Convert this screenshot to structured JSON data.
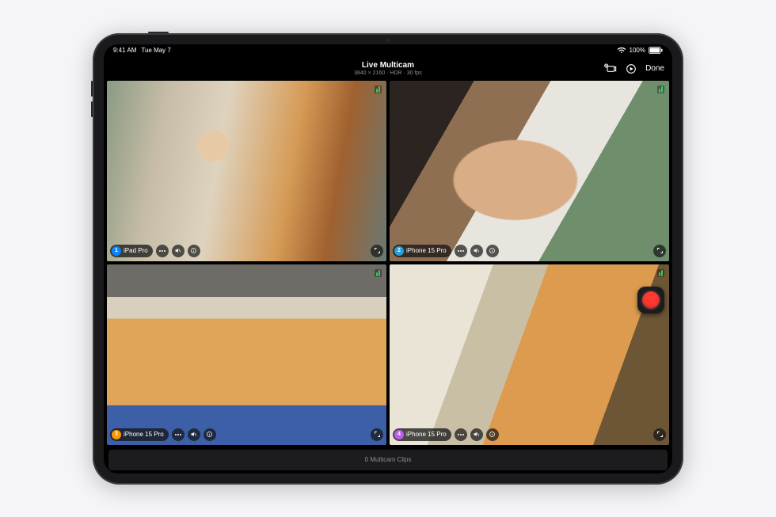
{
  "status": {
    "time": "9:41 AM",
    "date": "Tue May 7",
    "battery_pct": "100%"
  },
  "header": {
    "title": "Live Multicam",
    "subtitle": "3840 × 2160 · HDR · 30 fps",
    "done_label": "Done"
  },
  "feeds": [
    {
      "index_label": "1",
      "device_label": "iPad Pro"
    },
    {
      "index_label": "2",
      "device_label": "iPhone 15 Pro"
    },
    {
      "index_label": "3",
      "device_label": "iPhone 15 Pro"
    },
    {
      "index_label": "4",
      "device_label": "iPhone 15 Pro"
    }
  ],
  "clipbar": {
    "text": "0 Multicam Clips"
  }
}
